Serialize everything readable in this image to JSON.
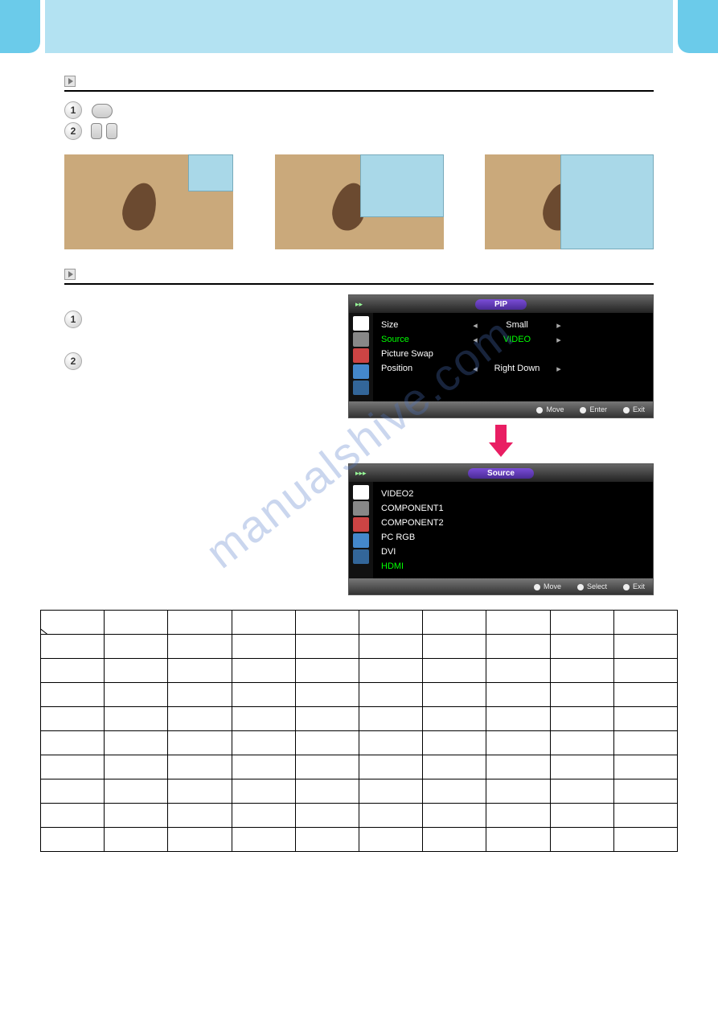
{
  "watermark": "manualshive.com",
  "section1": {
    "heading": ""
  },
  "section2": {
    "heading": ""
  },
  "steps": {
    "s1": "1",
    "s2": "2"
  },
  "osd1": {
    "title": "PIP",
    "rows": [
      {
        "label": "Size",
        "val": "Small",
        "cls": ""
      },
      {
        "label": "Source",
        "val": "VIDEO",
        "cls": "green"
      },
      {
        "label": "Picture Swap",
        "val": "",
        "cls": ""
      },
      {
        "label": "Position",
        "val": "Right Down",
        "cls": ""
      }
    ],
    "foot": {
      "a": "Move",
      "b": "Enter",
      "c": "Exit"
    }
  },
  "osd2": {
    "title": "Source",
    "items": [
      {
        "t": "VIDEO2",
        "cls": ""
      },
      {
        "t": "COMPONENT1",
        "cls": ""
      },
      {
        "t": "COMPONENT2",
        "cls": ""
      },
      {
        "t": "PC RGB",
        "cls": ""
      },
      {
        "t": "DVI",
        "cls": ""
      },
      {
        "t": "HDMI",
        "cls": "green"
      }
    ],
    "foot": {
      "a": "Move",
      "b": "Select",
      "c": "Exit"
    }
  },
  "table": {
    "headers": [
      "",
      "",
      "",
      "",
      "",
      "",
      "",
      "",
      "",
      ""
    ],
    "rows": 9
  }
}
